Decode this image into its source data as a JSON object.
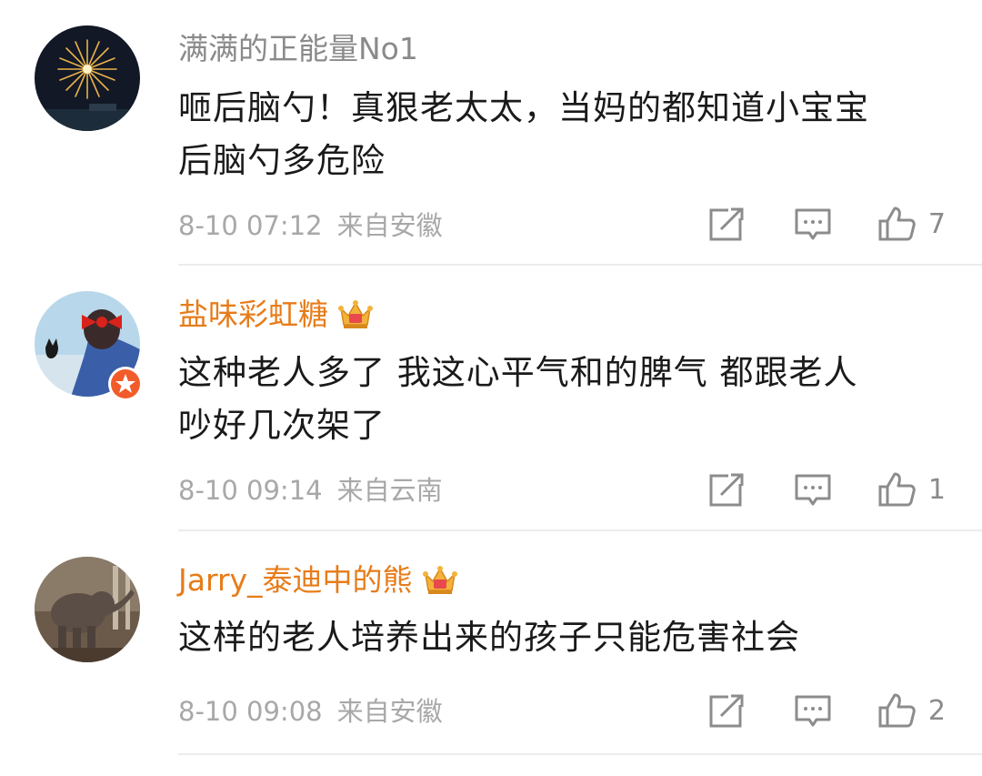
{
  "comments": [
    {
      "username": "满满的正能量No1",
      "vip": false,
      "text_lines": [
        "咂后脑勺！真狠老太太，当妈的都知道小宝宝",
        "后脑勺多危险"
      ],
      "date": "8-10 07:12",
      "source": "来自安徽",
      "likes": "7"
    },
    {
      "username": "盐味彩虹糖",
      "vip": true,
      "text_lines": [
        "这种老人多了  我这心平气和的脾气 都跟老人",
        "吵好几次架了"
      ],
      "date": "8-10 09:14",
      "source": "来自云南",
      "likes": "1"
    },
    {
      "username": "Jarry_泰迪中的熊",
      "vip": true,
      "text_lines": [
        "这样的老人培养出来的孩子只能危害社会"
      ],
      "date": "8-10 09:08",
      "source": "来自安徽",
      "likes": "2"
    }
  ],
  "icons": {
    "share": "share-icon",
    "reply": "comment-icon",
    "like": "thumbs-up-icon"
  },
  "colors": {
    "vip_name": "#e77c1a",
    "plain_name": "#8a8a8a",
    "text": "#1a1a1a",
    "meta": "#a8a8a8"
  }
}
